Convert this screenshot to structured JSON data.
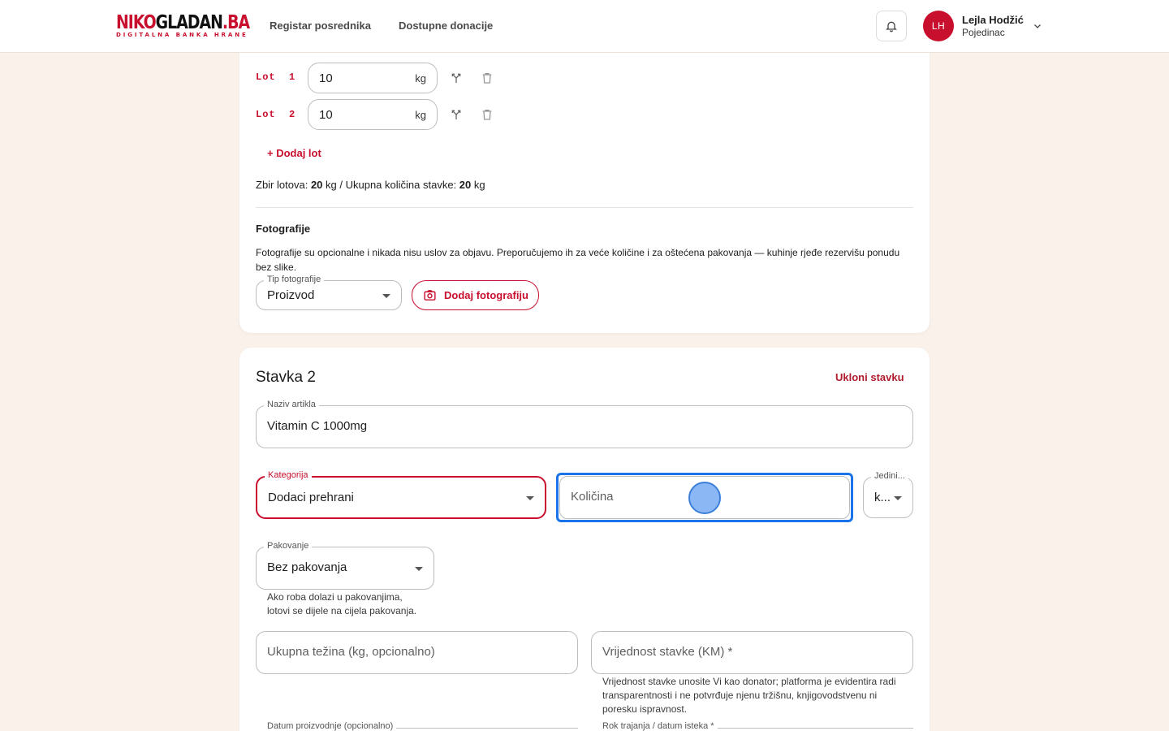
{
  "header": {
    "logo_a": "NIKO",
    "logo_b": "GLADAN",
    "logo_c": ".BA",
    "logo_sub": "DIGITALNA BANKA HRANE",
    "nav": [
      "Registar posrednika",
      "Dostupne donacije"
    ],
    "user": {
      "initials": "LH",
      "name": "Lejla Hodžić",
      "role": "Pojedinac"
    }
  },
  "stavka1": {
    "lots": [
      {
        "label": "Lot  1",
        "value": "10",
        "unit": "kg"
      },
      {
        "label": "Lot  2",
        "value": "10",
        "unit": "kg"
      }
    ],
    "add_lot": "+ Dodaj lot",
    "sum": {
      "prefix": "Zbir lotova:",
      "lots_total": "20",
      "unit1": "kg / Ukupna količina stavke:",
      "item_total": "20",
      "unit2": "kg"
    },
    "photos_title": "Fotografije",
    "photos_desc": "Fotografije su opcionalne i nikada nisu uslov za objavu. Preporučujemo ih za veće količine i za oštećena pakovanja — kuhinje rjeđe rezervišu ponudu bez slike.",
    "photo_type_label": "Tip fotografije",
    "photo_type_value": "Proizvod",
    "add_photo": "Dodaj fotografiju"
  },
  "stavka2": {
    "title": "Stavka 2",
    "remove": "Ukloni stavku",
    "naziv_label": "Naziv artikla",
    "naziv_value": "Vitamin C 1000mg",
    "kategorija_label": "Kategorija",
    "kategorija_value": "Dodaci prehrani",
    "kolicina_placeholder": "Količina",
    "jedinica_label": "Jedini...",
    "jedinica_value": "k...",
    "pakovanje_label": "Pakovanje",
    "pakovanje_value": "Bez pakovanja",
    "pakovanje_help_1": "Ako roba dolazi u pakovanjima,",
    "pakovanje_help_2": "lotovi se dijele na cijela pakovanja.",
    "tezina_placeholder": "Ukupna težina (kg, opcionalno)",
    "vrijednost_placeholder": "Vrijednost stavke (KM) *",
    "vrijednost_help": "Vrijednost stavke unosite Vi kao donator; platforma je evidentira radi transparentnosti i ne potvrđuje njenu tržišnu, knjigovodstvenu ni poresku ispravnost.",
    "datum_label": "Datum proizvodnje (opcionalno)",
    "rok_label": "Rok trajanja / datum isteka *"
  },
  "colors": {
    "brand": "#c8102e",
    "focus": "#1a73e8",
    "background": "#faf2ea"
  }
}
